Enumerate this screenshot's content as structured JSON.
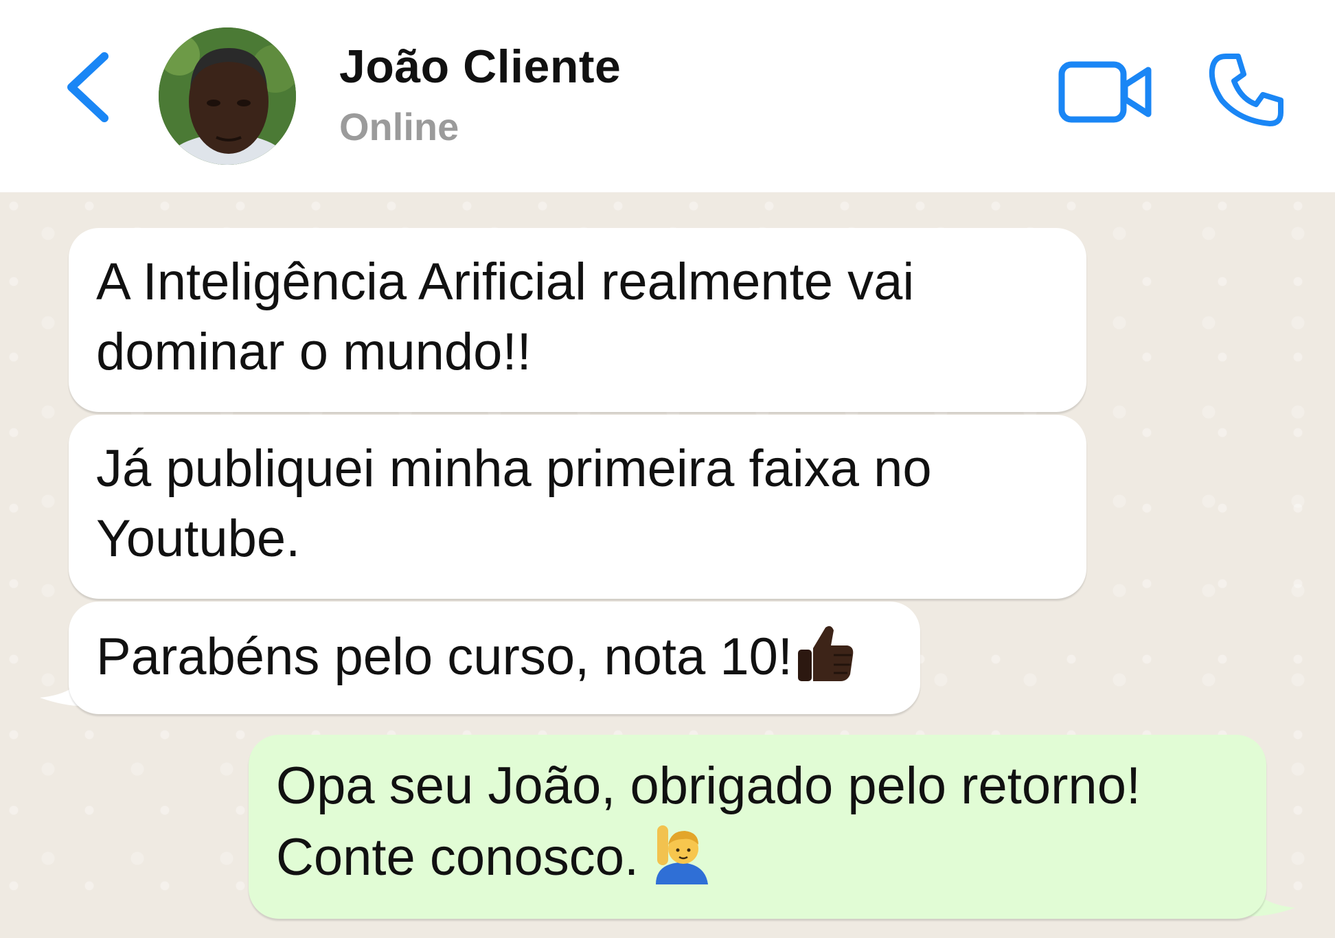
{
  "header": {
    "contact_name": "João Cliente",
    "status": "Online",
    "accent_color": "#1a86f5",
    "icons": [
      "chevron-left-icon",
      "video-camera-icon",
      "phone-icon"
    ]
  },
  "messages": [
    {
      "direction": "incoming",
      "text": "A Inteligência Arificial realmente vai dominar o mundo!!"
    },
    {
      "direction": "incoming",
      "text": "Já publiquei minha primeira faixa no Youtube."
    },
    {
      "direction": "incoming",
      "text": "Parabéns pelo curso, nota 10!",
      "emoji": "thumbs-up-icon"
    },
    {
      "direction": "outgoing",
      "text": "Opa seu João, obrigado pelo retorno! Conte conosco.",
      "emoji": "person-raising-hand-icon"
    }
  ],
  "colors": {
    "incoming_bubble": "#ffffff",
    "outgoing_bubble": "#e1fcd5",
    "chat_background": "#efeae2"
  }
}
